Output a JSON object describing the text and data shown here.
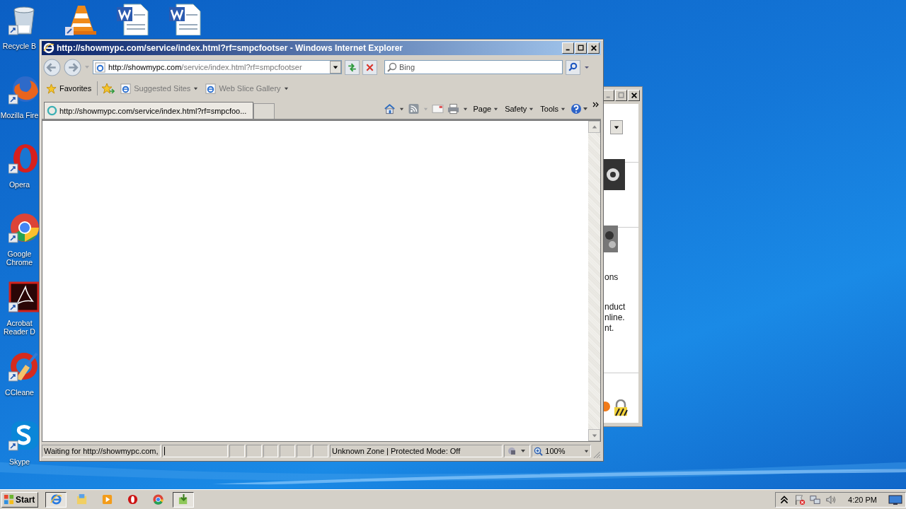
{
  "desktop_icons": [
    {
      "label": "Recycle B",
      "kind": "recycle"
    },
    {
      "label": "Mozilla Fire",
      "kind": "firefox"
    },
    {
      "label": "Opera",
      "kind": "opera"
    },
    {
      "label": "Google Chrome",
      "kind": "chrome"
    },
    {
      "label": "Acrobat Reader D",
      "kind": "acrobat"
    },
    {
      "label": "CCleane",
      "kind": "ccleaner"
    },
    {
      "label": "Skype",
      "kind": "skype"
    }
  ],
  "background_window": {
    "texts": [
      "ons",
      "nduct",
      "nline.",
      "nt."
    ]
  },
  "browser": {
    "title": "http://showmypc.com/service/index.html?rf=smpcfootser - Windows Internet Explorer",
    "address": {
      "host": "http://showmypc.com",
      "path": "/service/index.html?rf=smpcfootser"
    },
    "search": {
      "placeholder": "Bing"
    },
    "favorites_bar": [
      {
        "label": "Favorites",
        "kind": "favorites"
      },
      {
        "label": "Suggested Sites",
        "kind": "site"
      },
      {
        "label": "Web Slice Gallery",
        "kind": "site"
      }
    ],
    "tabs": [
      {
        "label": "http://showmypc.com/service/index.html?rf=smpcfoo...",
        "selected": true
      }
    ],
    "command_bar": [
      "Page",
      "Safety",
      "Tools"
    ],
    "status_bar": {
      "message": "Waiting for http://showmypc.com,",
      "zone": "Unknown Zone | Protected Mode: Off",
      "zoom": "100%"
    }
  },
  "taskbar": {
    "start": "Start",
    "items": [
      {
        "kind": "ie",
        "selected": true
      },
      {
        "kind": "explorer",
        "selected": false
      },
      {
        "kind": "media",
        "selected": false
      },
      {
        "kind": "opera",
        "selected": false
      },
      {
        "kind": "chrome",
        "selected": false
      },
      {
        "kind": "install",
        "selected": true
      }
    ],
    "clock": "4:20 PM"
  }
}
